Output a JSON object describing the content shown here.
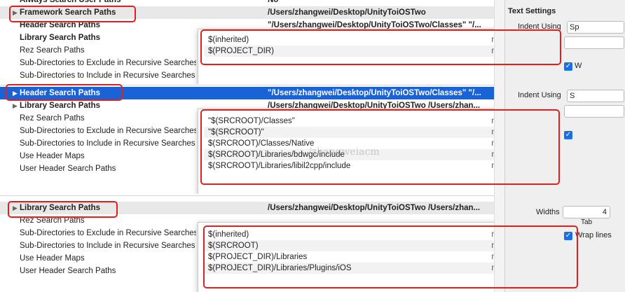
{
  "panel1": {
    "rows": [
      {
        "label": "Always Search User Paths",
        "value": "No"
      },
      {
        "label": "Framework Search Paths",
        "value": "/Users/zhangwei/Desktop/UnityToiOSTwo"
      },
      {
        "label": "Header Search Paths",
        "value": "\"/Users/zhangwei/Desktop/UnityToiOSTwo/Classes\" \"/..."
      },
      {
        "label": "Library Search Paths",
        "value": ""
      },
      {
        "label": "Rez Search Paths",
        "value": ""
      },
      {
        "label": "Sub-Directories to Exclude in Recursive Searches",
        "value": ""
      },
      {
        "label": "Sub-Directories to Include in Recursive Searches",
        "value": ""
      }
    ],
    "popup": [
      {
        "path": "$(inherited)",
        "mode": "non-recursive"
      },
      {
        "path": "$(PROJECT_DIR)",
        "mode": "non-recursive"
      }
    ]
  },
  "panel2": {
    "rows": [
      {
        "label": "Header Search Paths",
        "value": "\"/Users/zhangwei/Desktop/UnityToiOSTwo/Classes\" \"/..."
      },
      {
        "label": "Library Search Paths",
        "value": "/Users/zhangwei/Desktop/UnityToiOSTwo /Users/zhan..."
      },
      {
        "label": "Rez Search Paths",
        "value": ""
      },
      {
        "label": "Sub-Directories to Exclude in Recursive Searches",
        "value": ""
      },
      {
        "label": "Sub-Directories to Include in Recursive Searches",
        "value": ""
      },
      {
        "label": "Use Header Maps",
        "value": ""
      },
      {
        "label": "User Header Search Paths",
        "value": ""
      }
    ],
    "popup": [
      {
        "path": "\"$(SRCROOT)/Classes\"",
        "mode": "non-recursive"
      },
      {
        "path": "\"$(SRCROOT)\"",
        "mode": "non-recursive"
      },
      {
        "path": "$(SRCROOT)/Classes/Native",
        "mode": "non-recursive"
      },
      {
        "path": "$(SRCROOT)/Libraries/bdwgc/include",
        "mode": "non-recursive"
      },
      {
        "path": "$(SRCROOT)/Libraries/libil2cpp/include",
        "mode": "non-recursive"
      }
    ]
  },
  "panel3": {
    "rows": [
      {
        "label": "Library Search Paths",
        "value": "/Users/zhangwei/Desktop/UnityToiOSTwo /Users/zhan..."
      },
      {
        "label": "Rez Search Paths",
        "value": ""
      },
      {
        "label": "Sub-Directories to Exclude in Recursive Searches",
        "value": ""
      },
      {
        "label": "Sub-Directories to Include in Recursive Searches",
        "value": ""
      },
      {
        "label": "Use Header Maps",
        "value": ""
      },
      {
        "label": "User Header Search Paths",
        "value": ""
      }
    ],
    "popup": [
      {
        "path": "$(inherited)",
        "mode": "non-recursive"
      },
      {
        "path": "$(SRCROOT)",
        "mode": "non-recursive"
      },
      {
        "path": "$(PROJECT_DIR)/Libraries",
        "mode": "non-recursive"
      },
      {
        "path": "$(PROJECT_DIR)/Libraries/Plugins/iOS",
        "mode": "non-recursive"
      }
    ]
  },
  "sidebar": {
    "text_settings": "Text Settings",
    "indent_using": "Indent Using",
    "indent_value_1": "Sp",
    "indent_value_2": "S",
    "widths_label": "Widths",
    "widths_value": "4",
    "tab_label": "Tab",
    "wrap_lines": "Wrap lines",
    "w_cut": "W"
  },
  "watermark": "/zhangweiacm",
  "colors": {
    "selection": "#1a63d6",
    "highlight_box": "#e02020",
    "checkbox": "#1a6fe6"
  }
}
